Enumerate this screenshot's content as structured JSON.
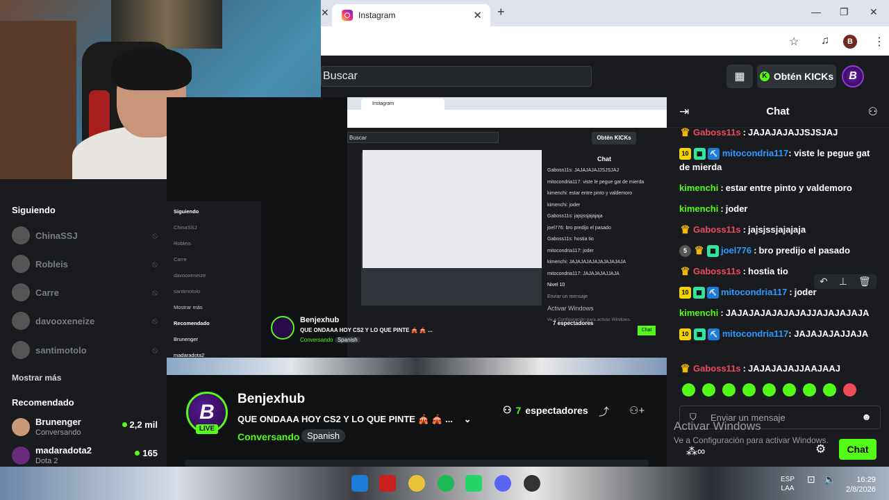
{
  "browser": {
    "tab_title": "Instagram",
    "tab_close": "✕",
    "left_close": "✕",
    "new_tab": "+",
    "profile_initial": "B"
  },
  "header": {
    "search_placeholder": "Buscar",
    "kicks_label": "Obtén KICKs",
    "avatar_letter": "B"
  },
  "sidebar": {
    "following_title": "Siguiendo",
    "following": [
      {
        "name": "ChinaSSJ"
      },
      {
        "name": "Robleis"
      },
      {
        "name": "Carre"
      },
      {
        "name": "davooxeneize"
      },
      {
        "name": "santimotolo"
      }
    ],
    "show_more": "Mostrar más",
    "recommended_title": "Recomendado",
    "recommended": [
      {
        "name": "Brunenger",
        "category": "Conversando",
        "viewers": "2,2 mil"
      },
      {
        "name": "madaradota2",
        "category": "Dota 2",
        "viewers": "165"
      }
    ]
  },
  "nested": {
    "tab_title": "Instagram",
    "search": "Buscar",
    "kicks": "Obtén KICKs",
    "chat_title": "Chat",
    "chat_lines": [
      "Gaboss11s: JAJAJAJAJJSJSJAJ",
      "mitocondria117: viste le pegue gat de mierda",
      "kimenchi: estar entre pinto y valdemoro",
      "kimenchi: joder",
      "Gaboss11s: jajsjssjajajaja",
      "joel776: bro predijo el pasado",
      "Gaboss11s: hostia tio",
      "mitocondria117: joder",
      "kimenchi: JAJAJAJAJAJAJAJAJAJA",
      "mitocondria117: JAJAJAJAJJAJA"
    ],
    "level_tag": "Nivel 10",
    "channel_name": "Benjexhub",
    "stream_title": "QUE ONDAAA HOY CS2 Y LO QUE PINTE 🎪 🎪 ...",
    "category": "Conversando",
    "language": "Spanish",
    "viewers": "7 espectadores",
    "input_placeholder": "Enviar un mensaje",
    "activate": "Activar Windows",
    "activate_sub": "Ve a Configuración para activar Windows.",
    "send": "Chat",
    "side_items": [
      "Siguiendo",
      "ChinaSSJ",
      "Robleis",
      "Carre",
      "davooxeneize",
      "santimotolo",
      "Mostrar más",
      "Recomendado",
      "Brunenger",
      "madaradota2"
    ]
  },
  "channel": {
    "avatar_letter": "B",
    "live_badge": "LIVE",
    "name": "Benjexhub",
    "title": "QUE ONDAAA HOY CS2 Y LO QUE PINTE 🎪 🎪 ...",
    "category": "Conversando",
    "language": "Spanish",
    "viewers_count": "7",
    "viewers_label": "espectadores"
  },
  "chat": {
    "title": "Chat",
    "messages": [
      {
        "user": "Gaboss11s",
        "color": "red",
        "badges": [
          "crown"
        ],
        "text": "JAJAJAJAJJSJSJAJ"
      },
      {
        "user": "mitocondria117",
        "color": "blue",
        "badges": [
          "10",
          "sub",
          "pick"
        ],
        "text": "viste le pegue gat de mierda",
        "wrap": true
      },
      {
        "user": "kimenchi",
        "color": "green",
        "badges": [],
        "text": "estar entre pinto y valdemoro"
      },
      {
        "user": "kimenchi",
        "color": "green",
        "badges": [],
        "text": "joder"
      },
      {
        "user": "Gaboss11s",
        "color": "red",
        "badges": [
          "crown"
        ],
        "text": "jajsjssjajajaja"
      },
      {
        "user": "joel776",
        "color": "blue",
        "badges": [
          "5",
          "crown",
          "sub"
        ],
        "text": "bro predijo el pasado"
      },
      {
        "user": "Gaboss11s",
        "color": "red",
        "badges": [
          "crown"
        ],
        "text": "hostia tio"
      },
      {
        "user": "mitocondria117",
        "color": "blue",
        "badges": [
          "10",
          "sub",
          "pick"
        ],
        "text": "joder"
      },
      {
        "user": "kimenchi",
        "color": "green",
        "badges": [],
        "text": "JAJAJAJAJAJAJAJJAJAJAJAJA"
      },
      {
        "user": "mitocondria117",
        "color": "blue",
        "badges": [
          "10",
          "sub",
          "pick"
        ],
        "text": "JAJAJAJAJJAJA",
        "wrap": true
      },
      {
        "user": "Gaboss11s",
        "color": "red",
        "badges": [
          "crown"
        ],
        "text": "JAJAJAJAJJAAJAAJ"
      }
    ],
    "input_placeholder": "Enviar un mensaje",
    "send_label": "Chat",
    "watermark": "Activar Windows",
    "watermark_sub": "Ve a Configuración para activar Windows."
  },
  "taskbar": {
    "lang": "ESP",
    "lang_sub": "LAA",
    "time": "16:29",
    "date": "2/8/2026"
  }
}
